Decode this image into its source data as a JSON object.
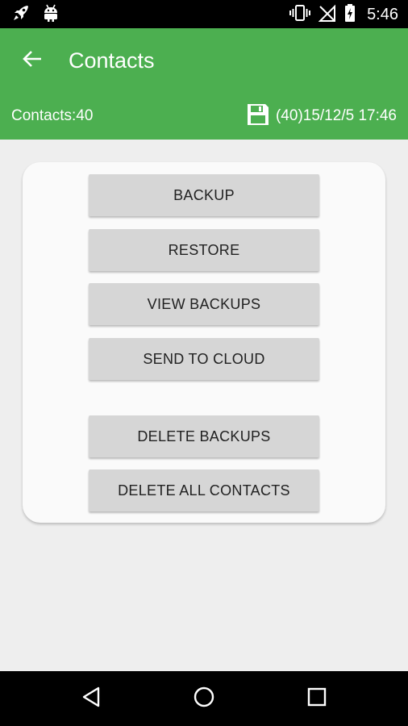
{
  "status_bar": {
    "time": "5:46",
    "left_icons": [
      "rocket-icon",
      "android-icon"
    ],
    "right_icons": [
      "vibrate-icon",
      "no-signal-icon",
      "battery-charging-icon"
    ]
  },
  "app_bar": {
    "title": "Contacts",
    "contacts_count": "Contacts:40",
    "last_backup": "(40)15/12/5 17:46",
    "back_icon": "arrow-back-icon",
    "backup_icon": "save-icon",
    "color": "#4caf50"
  },
  "actions": {
    "backup": "BACKUP",
    "restore": "RESTORE",
    "view_backups": "VIEW BACKUPS",
    "send_to_cloud": "SEND TO CLOUD",
    "delete_backups": "DELETE BACKUPS",
    "delete_all_contacts": "DELETE ALL CONTACTS"
  },
  "nav_bar": {
    "icons": [
      "back-triangle-icon",
      "home-circle-icon",
      "recents-square-icon"
    ]
  }
}
